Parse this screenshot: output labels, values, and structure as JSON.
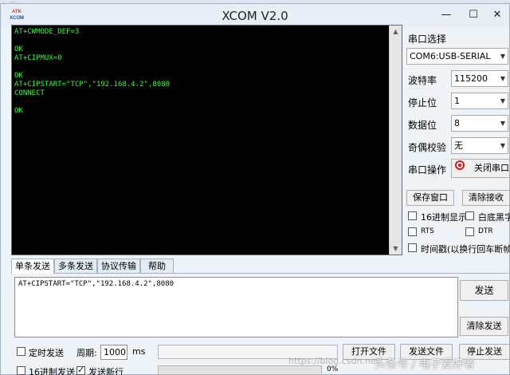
{
  "window": {
    "title": "XCOM V2.0",
    "app_icon_line1": "ATK",
    "app_icon_line2": "XCOM"
  },
  "terminal": {
    "text": "AT+CWMODE_DEF=3\n\nOK\nAT+CIPMUX=0\n\nOK\nAT+CIPSTART=\"TCP\",\"192.168.4.2\",8080\nCONNECT\n\nOK"
  },
  "settings": {
    "port_label": "串口选择",
    "port_value": "COM6:USB-SERIAL",
    "baud_label": "波特率",
    "baud_value": "115200",
    "stopbits_label": "停止位",
    "stopbits_value": "1",
    "databits_label": "数据位",
    "databits_value": "8",
    "parity_label": "奇偶校验",
    "parity_value": "无",
    "operation_label": "串口操作",
    "close_port_label": "关闭串口"
  },
  "buttons": {
    "save_window": "保存窗口",
    "clear_receive": "清除接收",
    "send": "发送",
    "clear_send": "清除发送",
    "open_file": "打开文件",
    "send_file": "发送文件",
    "stop_send": "停止发送"
  },
  "options": {
    "hex_display": "16进制显示",
    "white_black": "白底黑字",
    "rts": "RTS",
    "dtr": "DTR",
    "timestamp": "时间戳(以换行回车断帧)",
    "timed_send": "定时发送",
    "period_label": "周期:",
    "period_value": "1000",
    "period_unit": "ms",
    "hex_send": "16进制发送",
    "send_newline": "发送新行",
    "progress_text": "0%"
  },
  "tabs": [
    "单条发送",
    "多条发送",
    "协议传输",
    "帮助"
  ],
  "send": {
    "text": "AT+CIPSTART=\"TCP\",\"192.168.4.2\",8080"
  },
  "watermarks": {
    "url": "https://blog.csdn.net/",
    "brand": "头条号 / 电子爱好者"
  }
}
